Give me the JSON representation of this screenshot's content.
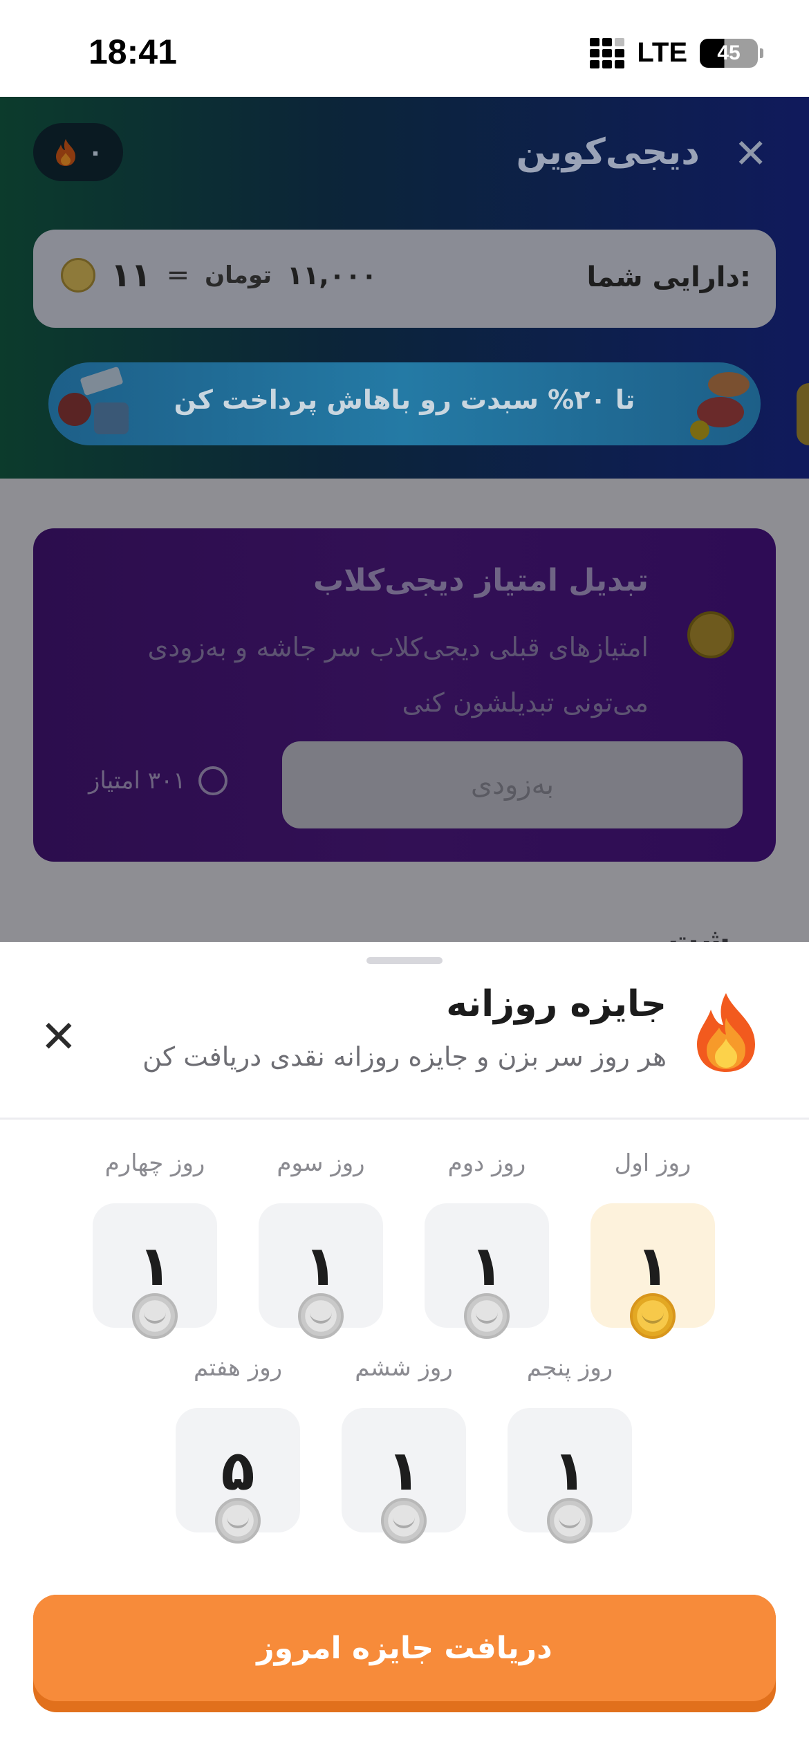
{
  "status_bar": {
    "time": "18:41",
    "network": "LTE",
    "battery": "45"
  },
  "header": {
    "title": "دیجی‌کوین",
    "streak_count": "۰"
  },
  "assets": {
    "label": "دارایی شما:",
    "coins": "۱۱",
    "equals": "=",
    "toman_value": "۱۱,۰۰۰",
    "toman_unit": "تومان"
  },
  "banner": {
    "text": "تا ۲۰% سبدت رو باهاش پرداخت کن"
  },
  "convert_card": {
    "title": "تبدیل امتیاز دیجی‌کلاب",
    "description": "امتیازهای قبلی دیجی‌کلاب سر جاشه و به‌زودی می‌تونی تبدیلشون کنی",
    "button_label": "به‌زودی",
    "points": "۳۰۱ امتیاز"
  },
  "background_section_title": "شت…",
  "sheet": {
    "title": "جایزه روزانه",
    "subtitle": "هر روز سر بزن و جایزه روزانه نقدی دریافت کن",
    "days": [
      {
        "label": "روز اول",
        "value": "۱",
        "active": true
      },
      {
        "label": "روز دوم",
        "value": "۱",
        "active": false
      },
      {
        "label": "روز سوم",
        "value": "۱",
        "active": false
      },
      {
        "label": "روز چهارم",
        "value": "۱",
        "active": false
      },
      {
        "label": "روز پنجم",
        "value": "۱",
        "active": false
      },
      {
        "label": "روز ششم",
        "value": "۱",
        "active": false
      },
      {
        "label": "روز هفتم",
        "value": "۵",
        "active": false
      }
    ],
    "claim_button": "دریافت جایزه امروز"
  },
  "colors": {
    "accent_orange": "#f78b3a",
    "active_day_bg": "#fdf2dc",
    "coin_gold": "#f7c94a"
  },
  "icons": {
    "close": "close-icon",
    "fire": "fire-icon",
    "coin": "coin-icon"
  }
}
